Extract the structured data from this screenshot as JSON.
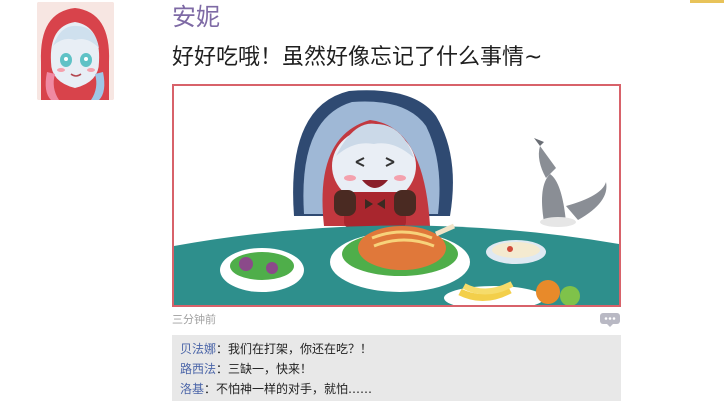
{
  "post": {
    "author": "安妮",
    "text": "好好吃哦！虽然好像忘记了什么事情~",
    "time": "三分钟前"
  },
  "comments": [
    {
      "name": "贝法娜",
      "sep": "：",
      "text": "我们在打架，你还在吃？！"
    },
    {
      "name": "路西法",
      "sep": "：",
      "text": "三缺一，快来！"
    },
    {
      "name": "洛基",
      "sep": "：",
      "text": "不怕神一样的对手，就怕……"
    }
  ],
  "icons": {
    "comment": "speech-bubble-icon"
  },
  "colors": {
    "author_name": "#7e6aa5",
    "commenter_name": "#4b65a8",
    "photo_border": "#d8626a",
    "comment_bg": "#e8e8e8"
  }
}
